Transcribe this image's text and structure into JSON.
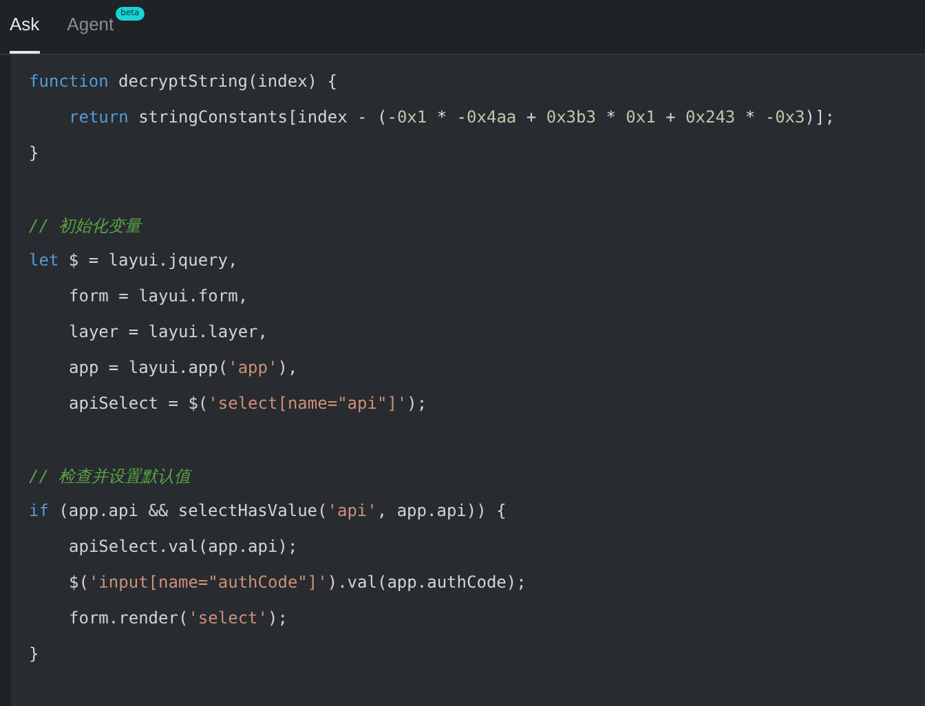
{
  "tabs": [
    {
      "label": "Ask",
      "selected": true
    },
    {
      "label": "Agent",
      "selected": false,
      "badge": "beta"
    }
  ],
  "code": {
    "blocks": [
      {
        "lines": [
          {
            "tokens": [
              {
                "kind": "keyword",
                "text": "function"
              },
              {
                "kind": "plain",
                "text": " decryptString(index) {"
              }
            ],
            "children": [
              {
                "tokens": [
                  {
                    "kind": "keyword",
                    "text": "return"
                  },
                  {
                    "kind": "plain",
                    "text": " stringConstants[index - (-"
                  },
                  {
                    "kind": "number",
                    "text": "0x1"
                  },
                  {
                    "kind": "plain",
                    "text": " * -"
                  },
                  {
                    "kind": "number",
                    "text": "0x4aa"
                  },
                  {
                    "kind": "plain",
                    "text": " + "
                  },
                  {
                    "kind": "number",
                    "text": "0x3b3"
                  },
                  {
                    "kind": "plain",
                    "text": " * "
                  },
                  {
                    "kind": "number",
                    "text": "0x1"
                  },
                  {
                    "kind": "plain",
                    "text": " + "
                  },
                  {
                    "kind": "number",
                    "text": "0x243"
                  },
                  {
                    "kind": "plain",
                    "text": " * -"
                  },
                  {
                    "kind": "number",
                    "text": "0x3"
                  },
                  {
                    "kind": "plain",
                    "text": ")];"
                  }
                ]
              }
            ]
          },
          {
            "tokens": [
              {
                "kind": "plain",
                "text": "}"
              }
            ]
          }
        ]
      },
      {
        "lines": [
          {
            "tokens": [
              {
                "kind": "comment",
                "text": "// 初始化变量"
              }
            ]
          },
          {
            "tokens": [
              {
                "kind": "keyword",
                "text": "let"
              },
              {
                "kind": "plain",
                "text": " $ = layui.jquery,"
              }
            ],
            "children": [
              {
                "tokens": [
                  {
                    "kind": "plain",
                    "text": "form = layui.form,"
                  }
                ]
              },
              {
                "tokens": [
                  {
                    "kind": "plain",
                    "text": "layer = layui.layer,"
                  }
                ]
              },
              {
                "tokens": [
                  {
                    "kind": "plain",
                    "text": "app = layui.app("
                  },
                  {
                    "kind": "string",
                    "text": "'app'"
                  },
                  {
                    "kind": "plain",
                    "text": "),"
                  }
                ]
              },
              {
                "tokens": [
                  {
                    "kind": "plain",
                    "text": "apiSelect = $("
                  },
                  {
                    "kind": "string",
                    "text": "'select[name=\"api\"]'"
                  },
                  {
                    "kind": "plain",
                    "text": ");"
                  }
                ]
              }
            ]
          }
        ]
      },
      {
        "lines": [
          {
            "tokens": [
              {
                "kind": "comment",
                "text": "// 检查并设置默认值"
              }
            ]
          },
          {
            "tokens": [
              {
                "kind": "keyword",
                "text": "if"
              },
              {
                "kind": "plain",
                "text": " (app.api && selectHasValue("
              },
              {
                "kind": "string",
                "text": "'api'"
              },
              {
                "kind": "plain",
                "text": ", app.api)) {"
              }
            ],
            "children": [
              {
                "tokens": [
                  {
                    "kind": "plain",
                    "text": "apiSelect.val(app.api);"
                  }
                ]
              },
              {
                "tokens": [
                  {
                    "kind": "plain",
                    "text": "$("
                  },
                  {
                    "kind": "string",
                    "text": "'input[name=\"authCode\"]'"
                  },
                  {
                    "kind": "plain",
                    "text": ").val(app.authCode);"
                  }
                ]
              },
              {
                "tokens": [
                  {
                    "kind": "plain",
                    "text": "form.render("
                  },
                  {
                    "kind": "string",
                    "text": "'select'"
                  },
                  {
                    "kind": "plain",
                    "text": ");"
                  }
                ]
              }
            ]
          },
          {
            "tokens": [
              {
                "kind": "plain",
                "text": "}"
              }
            ]
          }
        ]
      }
    ]
  }
}
